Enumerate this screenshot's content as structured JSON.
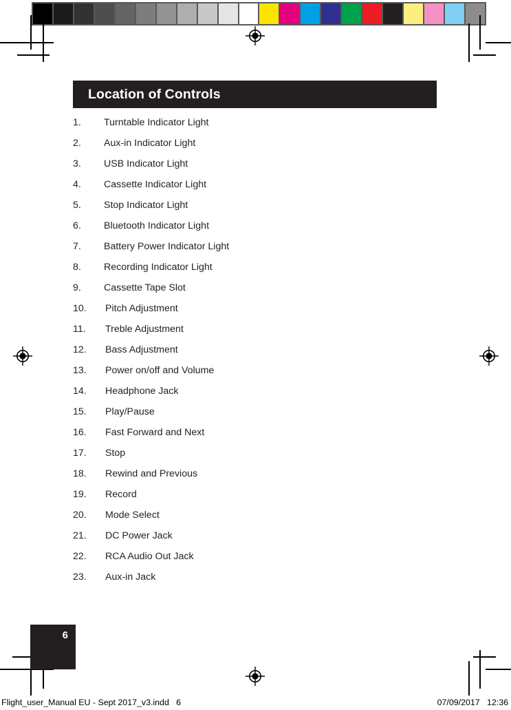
{
  "document": {
    "section_title": "Location of Controls",
    "page_number": "6"
  },
  "colorbars": {
    "grayscale_label": "grayscale-calibration-strip",
    "grayscale": [
      "#000000",
      "#1c1b1b",
      "#333232",
      "#4f4e4e",
      "#656464",
      "#7e7d7d",
      "#949393",
      "#b0afaf",
      "#c9c8c8",
      "#e5e5e5",
      "#ffffff"
    ],
    "spot_label": "process-color-calibration-strip",
    "spot": [
      "#fbe500",
      "#e5007d",
      "#00a0e4",
      "#2e3192",
      "#00a14b",
      "#ed1c24",
      "#231f20",
      "#fbef80",
      "#f490c3",
      "#7fd0f3",
      "#8c8c8c"
    ]
  },
  "controls": [
    {
      "num": "1.",
      "label": "Turntable Indicator Light"
    },
    {
      "num": "2.",
      "label": "Aux-in Indicator Light"
    },
    {
      "num": "3.",
      "label": "USB Indicator Light"
    },
    {
      "num": "4.",
      "label": "Cassette Indicator Light"
    },
    {
      "num": "5.",
      "label": "Stop Indicator Light"
    },
    {
      "num": "6.",
      "label": "Bluetooth Indicator Light"
    },
    {
      "num": "7.",
      "label": "Battery Power Indicator Light"
    },
    {
      "num": "8.",
      "label": "Recording Indicator Light"
    },
    {
      "num": "9.",
      "label": "Cassette Tape Slot"
    },
    {
      "num": "10.",
      "label": "Pitch Adjustment"
    },
    {
      "num": "11.",
      "label": "Treble Adjustment"
    },
    {
      "num": "12.",
      "label": "Bass Adjustment"
    },
    {
      "num": "13.",
      "label": "Power on/off and Volume"
    },
    {
      "num": "14.",
      "label": "Headphone Jack"
    },
    {
      "num": "15.",
      "label": "Play/Pause"
    },
    {
      "num": "16.",
      "label": "Fast Forward and Next"
    },
    {
      "num": "17.",
      "label": "Stop"
    },
    {
      "num": "18.",
      "label": "Rewind and Previous"
    },
    {
      "num": "19.",
      "label": "Record"
    },
    {
      "num": "20.",
      "label": "Mode Select"
    },
    {
      "num": "21.",
      "label": "DC Power Jack"
    },
    {
      "num": "22.",
      "label": "RCA Audio Out Jack"
    },
    {
      "num": "23.",
      "label": "Aux-in Jack"
    }
  ],
  "footer": {
    "filename_slug": "Flight_user_Manual EU - Sept 2017_v3.indd   6",
    "timestamp_slug": "07/09/2017   12:36"
  }
}
